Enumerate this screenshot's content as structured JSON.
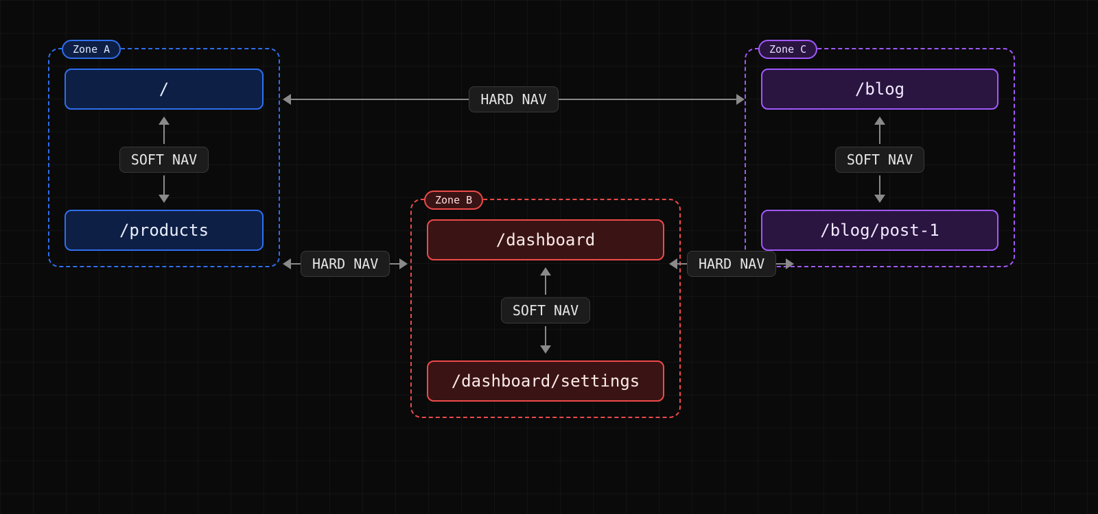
{
  "zones": {
    "a": {
      "label": "Zone A",
      "routes": [
        "/",
        "/products"
      ],
      "soft_nav": "SOFT NAV"
    },
    "b": {
      "label": "Zone B",
      "routes": [
        "/dashboard",
        "/dashboard/settings"
      ],
      "soft_nav": "SOFT NAV"
    },
    "c": {
      "label": "Zone C",
      "routes": [
        "/blog",
        "/blog/post-1"
      ],
      "soft_nav": "SOFT NAV"
    }
  },
  "hard_nav": {
    "a_c": "HARD NAV",
    "a_b": "HARD NAV",
    "b_c": "HARD NAV"
  },
  "colors": {
    "blue": "#2f6fed",
    "red": "#ef4a4a",
    "purple": "#a259ff"
  }
}
